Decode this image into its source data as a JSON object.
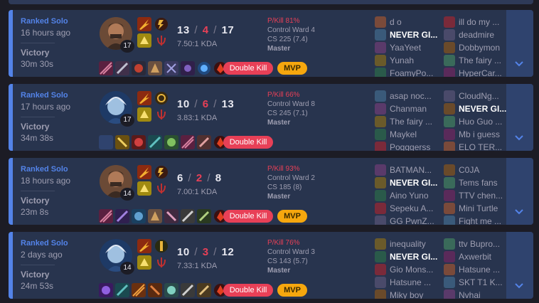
{
  "matches": [
    {
      "queue": "Ranked Solo",
      "time_ago": "16 hours ago",
      "result": "Victory",
      "duration": "30m 30s",
      "champion": "graves",
      "level": "17",
      "kills": "13",
      "deaths": "4",
      "assists": "17",
      "kda_ratio": "7.50:1 KDA",
      "pkill": "P/Kill 81%",
      "control_ward": "Control Ward 4",
      "cs": "CS 225 (7.4)",
      "rank": "Master",
      "badges": [
        "Double Kill",
        "MVP"
      ],
      "team1": [
        "d o",
        "NEVER GI...",
        "YaaYeet",
        "Yunah",
        "FoamyPo..."
      ],
      "team2": [
        "ill do my ...",
        "deadmire",
        "Dobbymon",
        "The fairy ...",
        "HyperCar..."
      ],
      "me_index": 1
    },
    {
      "queue": "Ranked Solo",
      "time_ago": "17 hours ago",
      "result": "Victory",
      "duration": "34m 38s",
      "champion": "ezreal",
      "level": "17",
      "kills": "10",
      "deaths": "6",
      "assists": "13",
      "kda_ratio": "3.83:1 KDA",
      "pkill": "P/Kill 66%",
      "control_ward": "Control Ward 8",
      "cs": "CS 245 (7.1)",
      "rank": "Master",
      "badges": [
        "Double Kill"
      ],
      "team1": [
        "asap noc...",
        "Chanman",
        "The fairy ...",
        "Maykel",
        "Pogggerss"
      ],
      "team2": [
        "CloudNg...",
        "NEVER GI...",
        "Huo Guo ...",
        "Mb i guess",
        "ELO TER..."
      ],
      "me_index": 6
    },
    {
      "queue": "Ranked Solo",
      "time_ago": "18 hours ago",
      "result": "Victory",
      "duration": "23m 8s",
      "champion": "graves",
      "level": "14",
      "kills": "6",
      "deaths": "2",
      "assists": "8",
      "kda_ratio": "7.00:1 KDA",
      "pkill": "P/Kill 93%",
      "control_ward": "Control Ward 2",
      "cs": "CS 185 (8)",
      "rank": "Master",
      "badges": [
        "Double Kill",
        "MVP"
      ],
      "team1": [
        "BATMAN...",
        "NEVER GI...",
        "Aino Yuno",
        "Sepeku A...",
        "GG PwnZ..."
      ],
      "team2": [
        "C0JA",
        "Tems fans",
        "TTV chen...",
        "Mini Turtle",
        "Fight me ..."
      ],
      "me_index": 1
    },
    {
      "queue": "Ranked Solo",
      "time_ago": "2 days ago",
      "result": "Victory",
      "duration": "24m 53s",
      "champion": "ezreal",
      "level": "14",
      "kills": "10",
      "deaths": "3",
      "assists": "12",
      "kda_ratio": "7.33:1 KDA",
      "pkill": "P/Kill 76%",
      "control_ward": "Control Ward 3",
      "cs": "CS 143 (5.7)",
      "rank": "Master",
      "badges": [
        "Double Kill",
        "MVP"
      ],
      "team1": [
        "inequality",
        "NEVER GI...",
        "Gio Mons...",
        "Hatsune ...",
        "Miky boy"
      ],
      "team2": [
        "ttv Bupro...",
        "Axwerbit",
        "Hatsune ...",
        "SKT T1 K...",
        "Nvhai"
      ],
      "me_index": 1
    }
  ],
  "colors": {
    "win_accent": "#5383e8",
    "death": "#e84057",
    "mvp": "#f6a70e",
    "card": "#28344e"
  }
}
